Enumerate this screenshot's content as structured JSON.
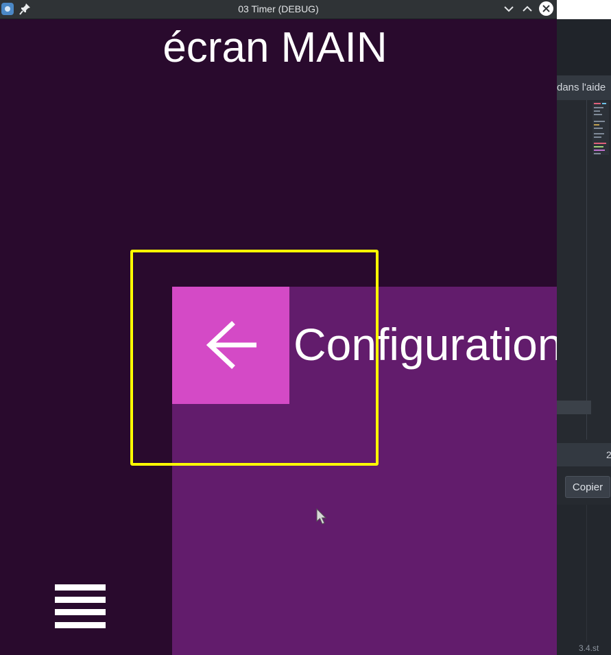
{
  "window": {
    "title": "03 Timer (DEBUG)"
  },
  "app": {
    "screen_title": "écran MAIN",
    "config_label": "Configuration",
    "back_button_icon": "arrow-left-icon",
    "menu_button_icon": "hamburger-menu-icon"
  },
  "ide": {
    "help_text": "dans l'aide",
    "copy_button": "Copier",
    "line_number": "2",
    "status_text": "3.4.st"
  },
  "colors": {
    "background": "#290a2d",
    "panel": "#621c6c",
    "back_button": "#d44ac6",
    "highlight": "#ffff00"
  }
}
